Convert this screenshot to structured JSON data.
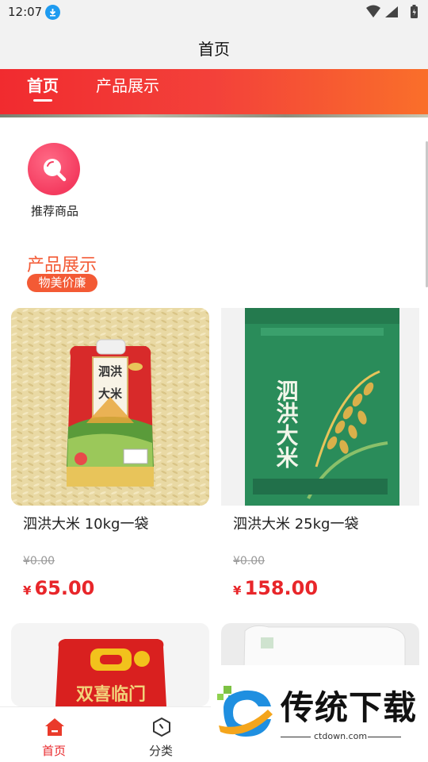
{
  "status_bar": {
    "time": "12:07"
  },
  "app_bar": {
    "title": "首页"
  },
  "tabs": [
    {
      "label": "首页",
      "active": true
    },
    {
      "label": "产品展示",
      "active": false
    }
  ],
  "quick_entry": {
    "label": "推荐商品",
    "icon": "search-icon"
  },
  "section": {
    "title": "产品展示",
    "badge": "物美价廉"
  },
  "products": [
    {
      "name": "泗洪大米 10kg一袋",
      "old_price": "¥0.00",
      "currency": "¥",
      "price": "65.00"
    },
    {
      "name": "泗洪大米 25kg一袋",
      "old_price": "¥0.00",
      "currency": "¥",
      "price": "158.00"
    }
  ],
  "bag_labels": {
    "bag1": "泗洪大米",
    "bag2": "泗洪大米",
    "bag3": "双喜临门"
  },
  "bottom_nav": [
    {
      "label": "首页",
      "icon": "home-icon",
      "active": true
    },
    {
      "label": "分类",
      "icon": "category-icon",
      "active": false
    }
  ],
  "watermark": {
    "text": "传统下载",
    "url": "ctdown.com"
  },
  "colors": {
    "accent": "#f35a35",
    "price": "#e8262a",
    "tab_gradient_start": "#f12b2f",
    "tab_gradient_end": "#fa6f2a",
    "nav_active": "#e8262a"
  }
}
